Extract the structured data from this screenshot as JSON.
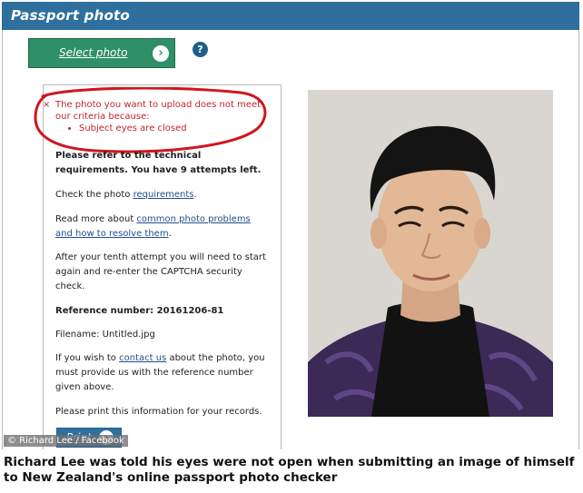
{
  "window": {
    "title": "Passport photo"
  },
  "toolbar": {
    "select_label": "Select photo",
    "select_arrow_icon": "chevron-right-icon",
    "help_icon": "help-icon",
    "help_glyph": "?"
  },
  "error": {
    "close_glyph": "×",
    "line1": "The photo you want to upload does not meet our criteria because:",
    "reason": "Subject eyes are closed",
    "highlight_color": "#d0161e"
  },
  "info": {
    "refer": "Please refer to the technical requirements. You have 9 attempts left.",
    "check_prefix": "Check the photo ",
    "check_link": "requirements",
    "check_suffix": ".",
    "read_prefix": "Read more about ",
    "read_link": "common photo problems and how to resolve them",
    "read_suffix": ".",
    "tenth": "After your tenth attempt you will need to start again and re-enter the CAPTCHA security check.",
    "reference": "Reference number: 20161206-81",
    "filename": "Filename: Untitled.jpg",
    "contact_prefix": "If you wish to ",
    "contact_link": "contact us",
    "contact_suffix": " about the photo, you must provide us with the reference number given above.",
    "print_note": "Please print this information for your records."
  },
  "print": {
    "label": "Print",
    "arrow_icon": "chevron-right-icon"
  },
  "credit": "© Richard Lee / Facebook",
  "caption": "Richard Lee was told his eyes were not open when submitting an image of himself to New Zealand's online passport photo checker",
  "colors": {
    "title_bar": "#2e6f9e",
    "select_button": "#2f8f67",
    "error_text": "#c0262c",
    "link": "#1f4e8c"
  }
}
